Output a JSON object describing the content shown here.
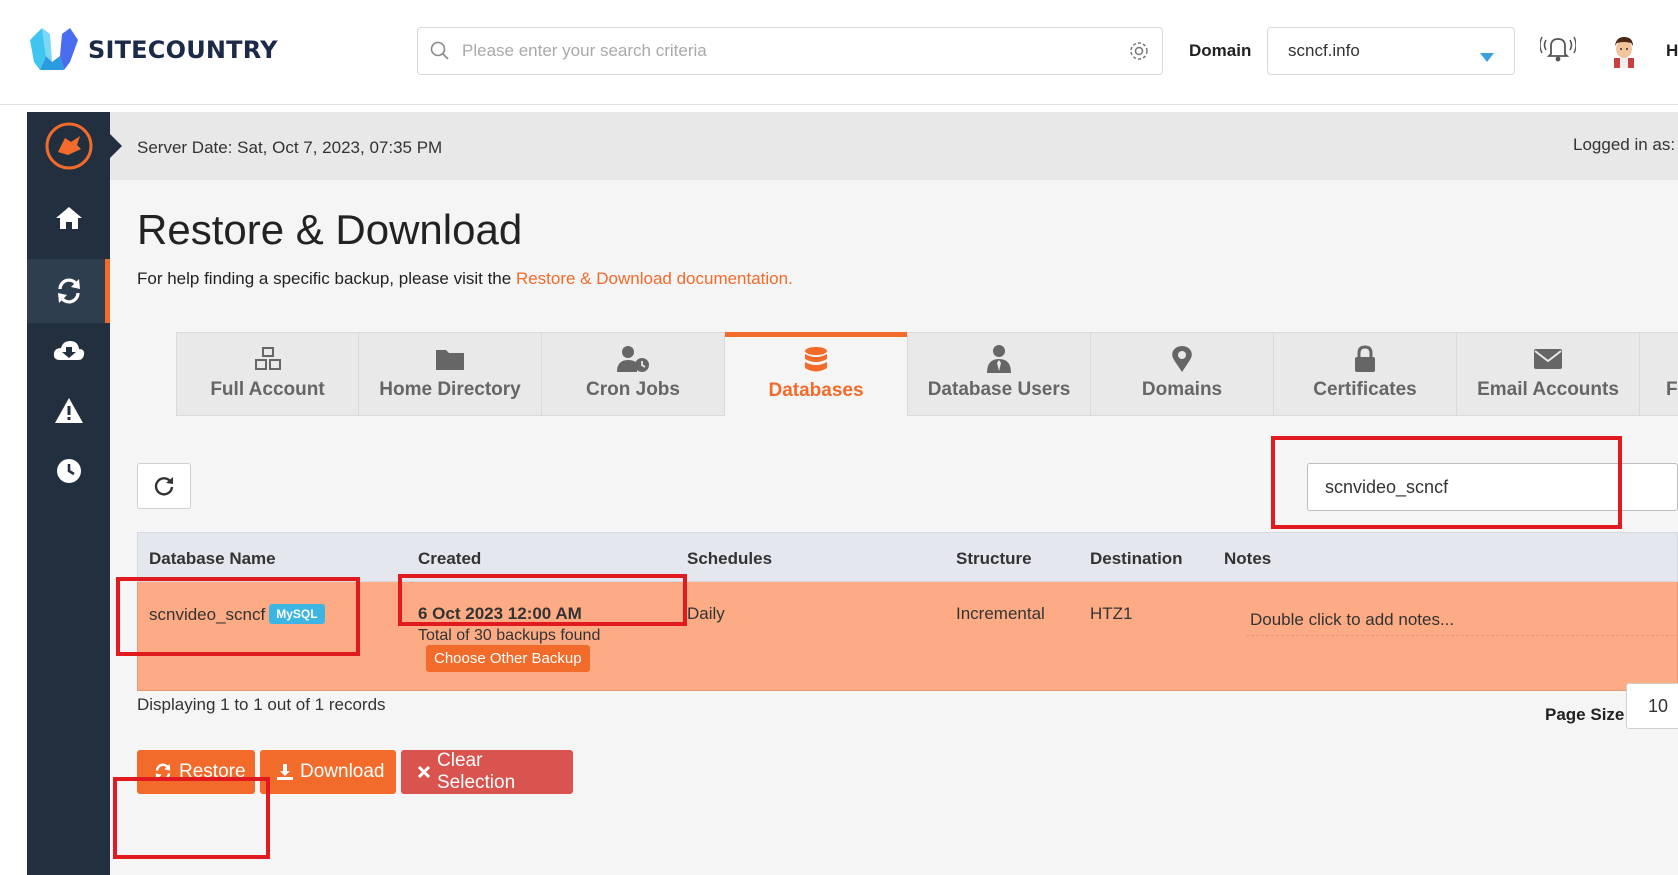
{
  "header": {
    "brand": "SITECOUNTRY",
    "search_placeholder": "Please enter your search criteria",
    "domain_label": "Domain",
    "domain_value": "scncf.info",
    "user_initial": "H"
  },
  "sidebar": {
    "items": [
      {
        "icon": "home-icon"
      },
      {
        "icon": "refresh-icon",
        "active": true
      },
      {
        "icon": "cloud-download-icon"
      },
      {
        "icon": "warning-icon"
      },
      {
        "icon": "clock-icon"
      }
    ]
  },
  "datebar": {
    "server_date": "Server Date: Sat, Oct 7, 2023, 07:35 PM",
    "logged_in": "Logged in as:"
  },
  "page": {
    "title": "Restore & Download",
    "help_text": "For help finding a specific backup, please visit the ",
    "help_link": "Restore & Download documentation."
  },
  "tabs": [
    {
      "label": "Full Account",
      "icon": "cubes-icon"
    },
    {
      "label": "Home Directory",
      "icon": "folder-icon"
    },
    {
      "label": "Cron Jobs",
      "icon": "user-clock-icon"
    },
    {
      "label": "Databases",
      "icon": "database-icon",
      "active": true
    },
    {
      "label": "Database Users",
      "icon": "user-tie-icon"
    },
    {
      "label": "Domains",
      "icon": "map-pin-icon"
    },
    {
      "label": "Certificates",
      "icon": "lock-icon"
    },
    {
      "label": "Email Accounts",
      "icon": "envelope-icon"
    },
    {
      "label": "F"
    }
  ],
  "filter": {
    "value": "scnvideo_scncf"
  },
  "table": {
    "headers": [
      "Database Name",
      "Created",
      "Schedules",
      "Structure",
      "Destination",
      "Notes"
    ],
    "rows": [
      {
        "name": "scnvideo_scncf",
        "badge": "MySQL",
        "created": "6 Oct 2023 12:00 AM",
        "backups_found": "Total of 30 backups found",
        "choose_other": "Choose Other Backup",
        "schedules": "Daily",
        "structure": "Incremental",
        "destination": "HTZ1",
        "notes": "Double click to add notes..."
      }
    ]
  },
  "footer": {
    "records": "Displaying 1 to 1 out of 1 records",
    "page_size_label": "Page Size",
    "page_size_value": "10"
  },
  "actions": {
    "restore": "Restore",
    "download": "Download",
    "clear": "Clear Selection"
  },
  "colors": {
    "accent": "#f26b2a",
    "sidebar": "#222f3e",
    "row_selected": "#fdab84",
    "danger": "#d9534f",
    "badge": "#3cb5e3",
    "annotation": "#e01a1f"
  }
}
